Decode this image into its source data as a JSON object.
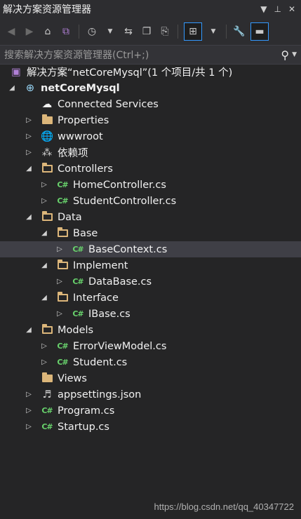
{
  "window": {
    "title": "解决方案资源管理器"
  },
  "search": {
    "placeholder": "搜索解决方案资源管理器(Ctrl+;)"
  },
  "tree": {
    "solution": "解决方案“netCoreMysql”(1 个项目/共 1 个)",
    "project": "netCoreMysql",
    "items": [
      "Connected Services",
      "Properties",
      "wwwroot",
      "依赖项",
      "Controllers",
      "HomeController.cs",
      "StudentController.cs",
      "Data",
      "Base",
      "BaseContext.cs",
      "Implement",
      "DataBase.cs",
      "Interface",
      "IBase.cs",
      "Models",
      "ErrorViewModel.cs",
      "Student.cs",
      "Views",
      "appsettings.json",
      "Program.cs",
      "Startup.cs"
    ],
    "cs_glyph": "C#"
  },
  "watermark": "https://blog.csdn.net/qq_40347722",
  "colors": {
    "background": "#252526",
    "selected": "#3f3f46",
    "folder": "#dcb67a",
    "csharp": "#68d26c",
    "accent": "#3399ff"
  }
}
